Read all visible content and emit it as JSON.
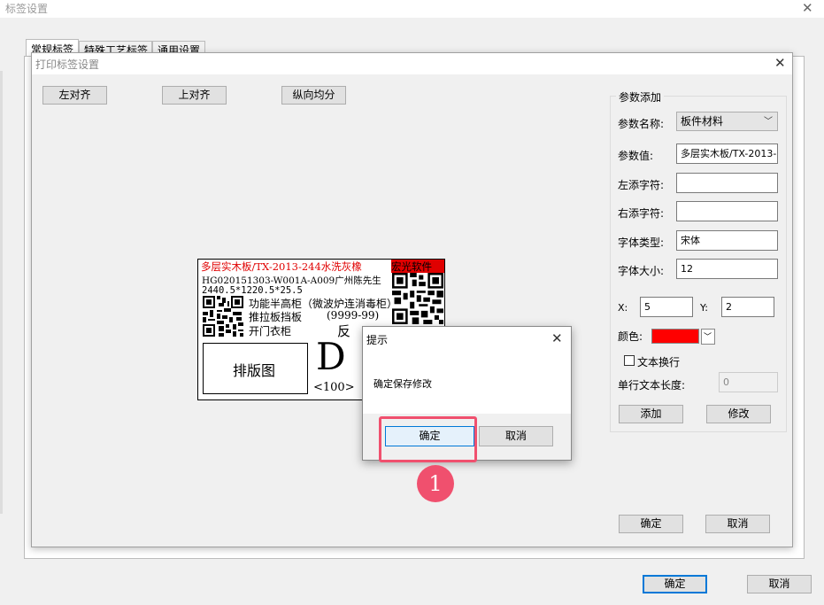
{
  "outer": {
    "title": "标签设置",
    "tabs": [
      "常规标签",
      "特殊工艺标签",
      "通用设置"
    ],
    "ok_label": "确定",
    "cancel_label": "取消"
  },
  "print_dialog": {
    "title": "打印标签设置",
    "toolbar": {
      "align_left": "左对齐",
      "align_top": "上对齐",
      "distribute_vertical": "纵向均分"
    },
    "ok_label": "确定",
    "cancel_label": "取消"
  },
  "label_preview": {
    "line1": "多层实木板/TX-2013-244水洗灰橡",
    "corner_text": "宏光软件",
    "line2": "HG020151303-W001A-A009广州陈先生",
    "line3": "2440.5*1220.5*25.5",
    "line4": "功能半高柜（微波炉连消毒柜）",
    "line5": "推拉板挡板",
    "line5_code": "(9999-99)",
    "line6": "开门衣柜",
    "line6_mark": "反",
    "layout_box": "排版图",
    "big_letter": "D",
    "count": "<100>"
  },
  "params": {
    "group_title": "参数添加",
    "name_label": "参数名称:",
    "name_value": "板件材料",
    "value_label": "参数值:",
    "value_value": "多层实木板/TX-2013-",
    "left_label": "左添字符:",
    "left_value": "",
    "right_label": "右添字符:",
    "right_value": "",
    "font_type_label": "字体类型:",
    "font_type_value": "宋体",
    "font_size_label": "字体大小:",
    "font_size_value": "12",
    "x_label": "X:",
    "x_value": "5",
    "y_label": "Y:",
    "y_value": "2",
    "color_label": "颜色:",
    "color_value": "#ff0000",
    "wrap_label": "文本换行",
    "wrap_checked": false,
    "line_len_label": "单行文本长度:",
    "line_len_value": "0",
    "add_label": "添加",
    "modify_label": "修改"
  },
  "confirm_dialog": {
    "title": "提示",
    "message": "确定保存修改",
    "ok_label": "确定",
    "cancel_label": "取消"
  },
  "annotation": {
    "step": "1",
    "highlight_color": "#f0506e"
  }
}
